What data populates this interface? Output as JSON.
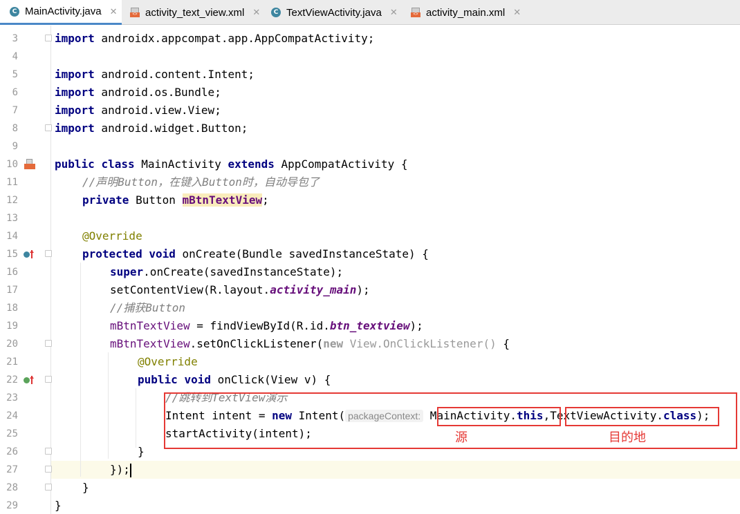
{
  "tabs": [
    {
      "label": "MainActivity.java",
      "icon": "java-class-icon",
      "active": true
    },
    {
      "label": "activity_text_view.xml",
      "icon": "xml-file-icon",
      "active": false
    },
    {
      "label": "TextViewActivity.java",
      "icon": "java-class-icon",
      "active": false
    },
    {
      "label": "activity_main.xml",
      "icon": "xml-file-icon",
      "active": false
    }
  ],
  "close_glyph": "✕",
  "line_numbers": [
    "3",
    "4",
    "5",
    "6",
    "7",
    "8",
    "9",
    "10",
    "11",
    "12",
    "13",
    "14",
    "15",
    "16",
    "17",
    "18",
    "19",
    "20",
    "21",
    "22",
    "23",
    "24",
    "25",
    "26",
    "27",
    "28",
    "29"
  ],
  "code": {
    "l3": {
      "kw": "import",
      "rest": " androidx.appcompat.app.AppCompatActivity;"
    },
    "l5": {
      "kw": "import",
      "rest": " android.content.Intent;"
    },
    "l6": {
      "kw": "import",
      "rest": " android.os.Bundle;"
    },
    "l7": {
      "kw": "import",
      "rest": " android.view.View;"
    },
    "l8": {
      "kw": "import",
      "rest": " android.widget.Button;"
    },
    "l10": {
      "kw1": "public",
      "kw2": "class",
      "name": " MainActivity ",
      "kw3": "extends",
      "rest": " AppCompatActivity {"
    },
    "l11": {
      "comment": "//声明Button，在键入Button时，自动导包了"
    },
    "l12": {
      "kw": "private",
      "type": " Button ",
      "field": "mBtnTextView",
      "rest": ";"
    },
    "l14": {
      "ann": "@Override"
    },
    "l15": {
      "kw1": "protected",
      "kw2": "void",
      "rest": " onCreate(Bundle savedInstanceState) {"
    },
    "l16": {
      "kw": "super",
      "rest": ".onCreate(savedInstanceState);"
    },
    "l17": {
      "pre": "setContentView(R.layout.",
      "field": "activity_main",
      "post": ");"
    },
    "l18": {
      "comment": "//捕获Button"
    },
    "l19": {
      "field": "mBtnTextView",
      "pre": " = findViewById(R.id.",
      "field2": "btn_textview",
      "post": ");"
    },
    "l20": {
      "field": "mBtnTextView",
      "pre": ".setOnClickListener(",
      "kw": "new",
      "gray": " View.OnClickListener()",
      "post": " {"
    },
    "l21": {
      "ann": "@Override"
    },
    "l22": {
      "kw1": "public",
      "kw2": "void",
      "rest": " onClick(View v) {"
    },
    "l23": {
      "comment": "//跳转到TextView演示"
    },
    "l24": {
      "pre": "Intent intent = ",
      "kw": "new",
      "mid": " Intent(",
      "hint": "packageContext:",
      "arg1a": " MainActivity.",
      "kw2": "this",
      "comma": ",",
      "arg2a": "TextViewActivity.",
      "kw3": "class",
      "post": ");"
    },
    "l25": {
      "text": "startActivity(intent);"
    },
    "l26": {
      "text": "}"
    },
    "l27": {
      "text": "});"
    },
    "l28": {
      "text": "}"
    },
    "l29": {
      "text": "}"
    }
  },
  "annotations": {
    "source_label": "源",
    "destination_label": "目的地"
  },
  "colors": {
    "keyword": "#000080",
    "comment": "#808080",
    "annotation": "#808000",
    "field": "#660e7a",
    "highlight_box": "#e53935"
  }
}
